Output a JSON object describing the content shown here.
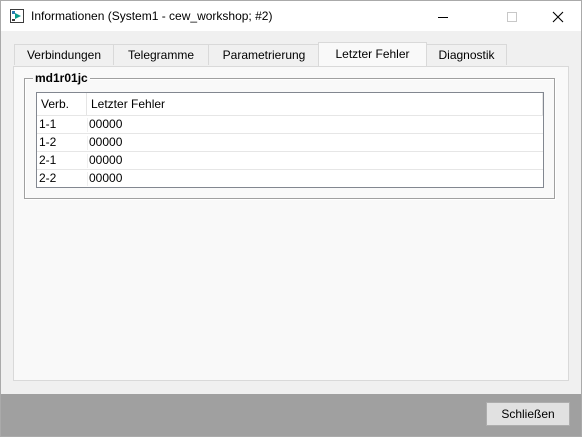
{
  "window": {
    "title": "Informationen (System1 - cew_workshop; #2)"
  },
  "tabs": [
    {
      "label": "Verbindungen",
      "active": false
    },
    {
      "label": "Telegramme",
      "active": false
    },
    {
      "label": "Parametrierung",
      "active": false
    },
    {
      "label": "Letzter Fehler",
      "active": true
    },
    {
      "label": "Diagnostik",
      "active": false
    }
  ],
  "group": {
    "title": "md1r01jc"
  },
  "table": {
    "headers": [
      "Verb.",
      "Letzter Fehler"
    ],
    "rows": [
      [
        "1-1",
        "00000"
      ],
      [
        "1-2",
        "00000"
      ],
      [
        "2-1",
        "00000"
      ],
      [
        "2-2",
        "00000"
      ]
    ]
  },
  "footer": {
    "close_label": "Schließen"
  },
  "icons": {
    "app": "application-icon",
    "minimize": "minimize-icon",
    "maximize": "maximize-icon",
    "close": "close-icon"
  },
  "colors": {
    "footer_bar": "#a0a0a0",
    "panel": "#f9f9f9",
    "window": "#f0f0f0"
  }
}
